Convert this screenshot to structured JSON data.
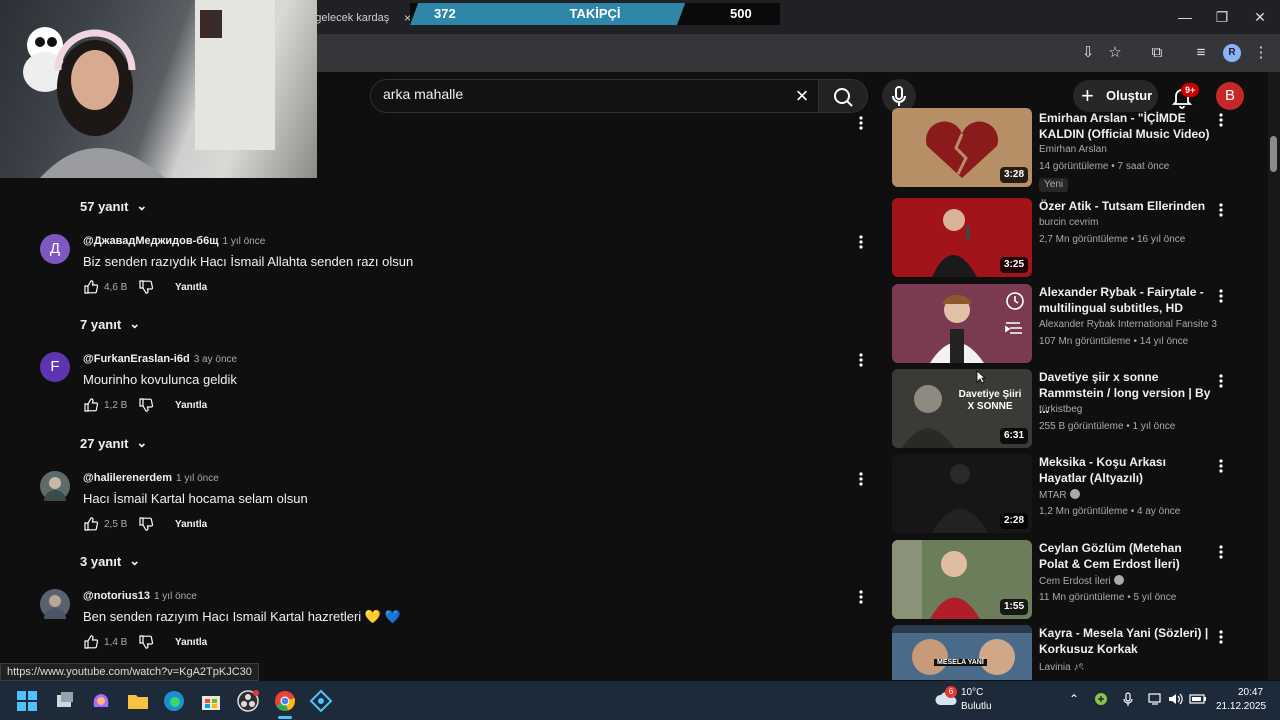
{
  "browser": {
    "tab_title": "ah gelecek kardaş",
    "tab_close": "×",
    "controls": {
      "minimize": "—",
      "maximize": "❐",
      "close": "✕"
    }
  },
  "overlay": {
    "current": "372",
    "label": "TAKİPÇİ",
    "goal": "500",
    "progress": 0.744
  },
  "youtube": {
    "search_query": "arka mahalle",
    "create_label": "Oluştur",
    "notification_count": "9+",
    "avatar_letter": "B",
    "browser_profile": "R"
  },
  "replies_toggles": [
    {
      "label": "57 yanıt"
    },
    {
      "label": "7 yanıt"
    },
    {
      "label": "27 yanıt"
    },
    {
      "label": "3 yanıt"
    }
  ],
  "comments": [
    {
      "avatar": "Д",
      "avatar_color": "#7e57c2",
      "handle": "@ДжавадМеджидов-б6щ",
      "time": "1 yıl önce",
      "text": "Biz senden razıydık Hacı İsmail Allahta senden razı olsun",
      "likes": "4,6 B",
      "reply_label": "Yanıtla"
    },
    {
      "avatar": "F",
      "avatar_color": "#5e35b1",
      "handle": "@FurkanEraslan-i6d",
      "time": "3 ay önce",
      "text": "Mourinho kovulunca geldik",
      "likes": "1,2 B",
      "reply_label": "Yanıtla"
    },
    {
      "avatar": "",
      "avatar_color": "#5d6b6b",
      "handle": "@halilerenerdem",
      "time": "1 yıl önce",
      "text": "Hacı İsmail Kartal hocama selam olsun",
      "likes": "2,5 B",
      "reply_label": "Yanıtla"
    },
    {
      "avatar": "",
      "avatar_color": "#5a6270",
      "handle": "@notorius13",
      "time": "1 yıl önce",
      "text": "Ben senden razıyım Hacı Ismail Kartal hazretleri 💛 💙",
      "likes": "1,4 B",
      "reply_label": "Yanıtla"
    }
  ],
  "recommendations": [
    {
      "title": "Emirhan Arslan - \"İÇİMDE KALDIN (Official Music Video)",
      "channel": "Emirhan Arslan",
      "meta": "14 görüntüleme • 7 saat önce",
      "duration": "3:28",
      "badge": "Yeni",
      "thumb_color": "#b78f66"
    },
    {
      "title": "Özer Atik - Tutsam Ellerinden",
      "channel": "burcin cevrim",
      "meta": "2,7 Mn görüntüleme • 16 yıl önce",
      "duration": "3:25",
      "thumb_color": "#a2141a"
    },
    {
      "title": "Alexander Rybak - Fairytale - multilingual subtitles, HD",
      "channel": "Alexander Rybak International Fansite 3",
      "meta": "107 Mn görüntüleme • 14 yıl önce",
      "duration": "",
      "thumb_color": "#7a3a52"
    },
    {
      "title": "Davetiye şiir x sonne Rammstein / long version | By ...",
      "channel": "türkistbeg",
      "meta": "255 B görüntüleme • 1 yıl önce",
      "duration": "6:31",
      "thumb_color": "#3b3a36",
      "thumb_caption_1": "Davetiye Şiiri",
      "thumb_caption_2": "X SONNE"
    },
    {
      "title": "Meksika - Koşu Arkası Hayatlar (Altyazılı)",
      "channel": "MTAR",
      "meta": "1,2 Mn görüntüleme • 4 ay önce",
      "duration": "2:28",
      "thumb_color": "#161616",
      "verified": true
    },
    {
      "title": "Ceylan Gözlüm (Metehan Polat & Cem Erdost İleri)",
      "channel": "Cem Erdost İleri",
      "meta": "11 Mn görüntüleme • 5 yıl önce",
      "duration": "1:55",
      "thumb_color": "#6b7d5a",
      "verified": true
    },
    {
      "title": "Kayra - Mesela Yani (Sözleri) | Korkusuz Korkak",
      "channel": "Lavinia ♪ৎ",
      "meta": "",
      "duration": "",
      "thumb_color": "#4a6a8a",
      "thumb_caption_1": "MESELA YANİ"
    }
  ],
  "status_url": "https://www.youtube.com/watch?v=KgA2TpKJC30",
  "taskbar": {
    "weather_temp": "10°C",
    "weather_desc": "Bulutlu",
    "weather_badge": "6",
    "time": "20:47",
    "date": "21.12.2025"
  }
}
